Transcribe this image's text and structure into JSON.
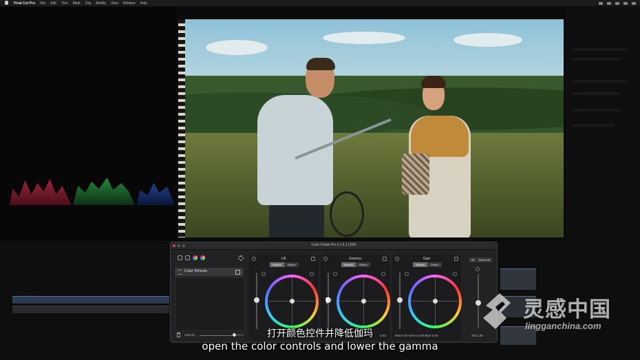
{
  "menubar": {
    "app_name": "Final Cut Pro",
    "items": [
      "File",
      "Edit",
      "Trim",
      "Mark",
      "Clip",
      "Modify",
      "View",
      "Window",
      "Help"
    ]
  },
  "color_finale": {
    "window_title": "Color Finale Pro v.1.6.1 (169)",
    "layer_name": "Color Wheels",
    "opacity_label": "Opacity",
    "opacity_value": "100%",
    "tabs": [
      "Wheels",
      "Sliders"
    ],
    "wheels": [
      {
        "title": "Lift"
      },
      {
        "title": "Gamma"
      },
      {
        "title": "Gain"
      }
    ],
    "readouts": [
      {
        "label": "Red",
        "value": "0.00"
      },
      {
        "label": "Green",
        "value": "0.00"
      },
      {
        "label": "Blue",
        "value": "0.00"
      }
    ],
    "gamma_readout": "0.00",
    "all_button": "All",
    "reset_all_button": "Reset All",
    "sat_label": "Sat",
    "sat_value": "1.00"
  },
  "subtitles": {
    "chinese": "打开颜色控件并降低伽玛",
    "english": "open the color controls and lower the gamma"
  },
  "watermark": {
    "brand": "灵感中国",
    "url": "lingganchina.com"
  },
  "colors": {
    "wheel_accent": "#ff33ff",
    "panel_bg": "#222224"
  }
}
